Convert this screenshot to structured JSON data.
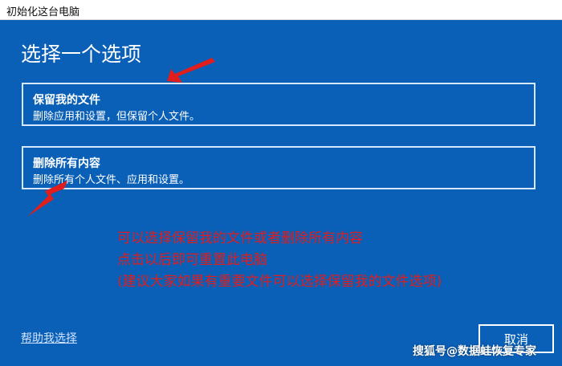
{
  "window": {
    "title": "初始化这台电脑"
  },
  "dialog": {
    "heading": "选择一个选项",
    "options": [
      {
        "title": "保留我的文件",
        "description": "删除应用和设置，但保留个人文件。"
      },
      {
        "title": "删除所有内容",
        "description": "删除所有个人文件、应用和设置。"
      }
    ],
    "help_link": "帮助我选择",
    "cancel_label": "取消"
  },
  "annotation": {
    "lines": [
      "可以选择保留我的文件或者删除所有内容",
      "点击以后即可重置此电脑",
      "(建议大家如果有重要文件可以选择保留我的文件选项)"
    ]
  },
  "watermark": "搜狐号@数据蛙恢复专家",
  "colors": {
    "background": "#0a5fb7",
    "option_border": "#d6e8ff",
    "annotation": "#e01e1e",
    "arrow": "#e01e1e"
  }
}
